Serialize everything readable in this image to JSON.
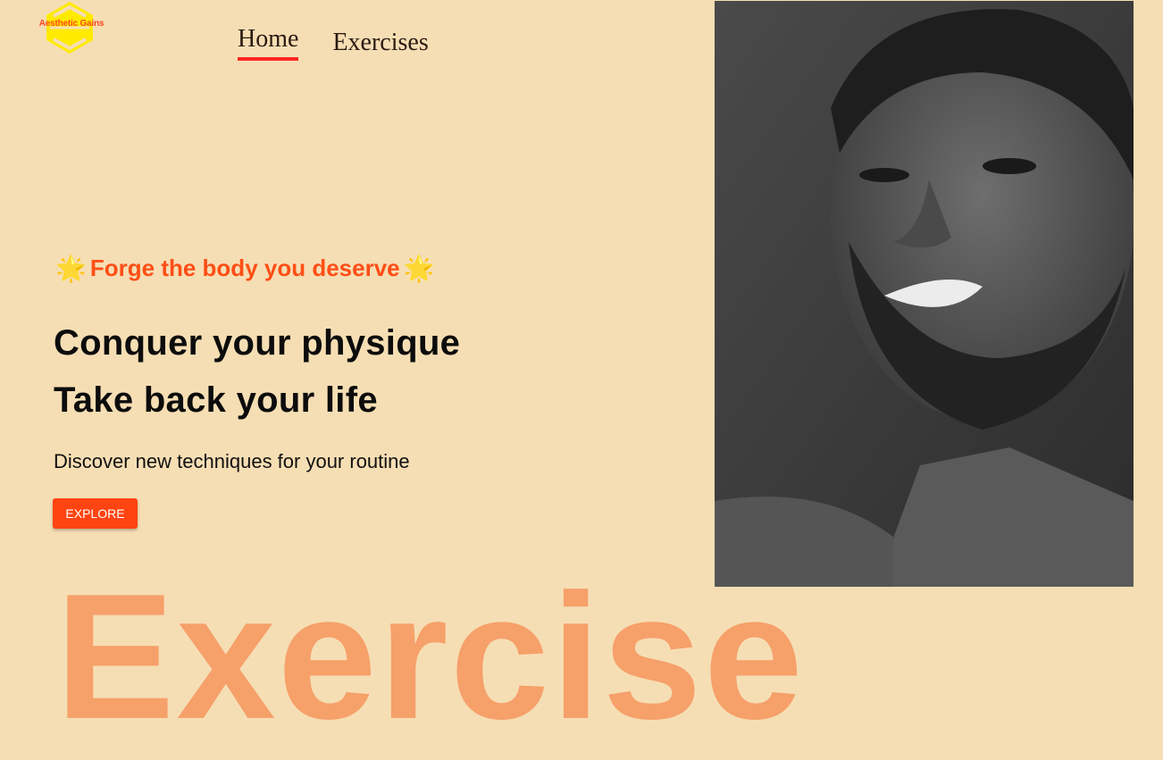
{
  "brand": {
    "name": "Aesthetic Gains",
    "logo_color": "#ffea00",
    "text_color": "#ff4a1c"
  },
  "nav": {
    "items": [
      {
        "label": "Home",
        "active": true
      },
      {
        "label": "Exercises",
        "active": false
      }
    ]
  },
  "hero": {
    "tagline": "Forge the body you deserve",
    "tagline_icon": "glowing-star-icon",
    "headline_line1": "Conquer your physique",
    "headline_line2": "Take back your life",
    "subtitle": "Discover new techniques for your routine",
    "cta_label": "EXPLORE"
  },
  "banner_word": "Exercise",
  "colors": {
    "background": "#f6deb4",
    "accent": "#ff4411",
    "nav_underline": "#ff2625",
    "banner_word": "#f6a06a"
  },
  "hero_image": {
    "subject": "grayscale portrait of a smiling bearded man"
  }
}
